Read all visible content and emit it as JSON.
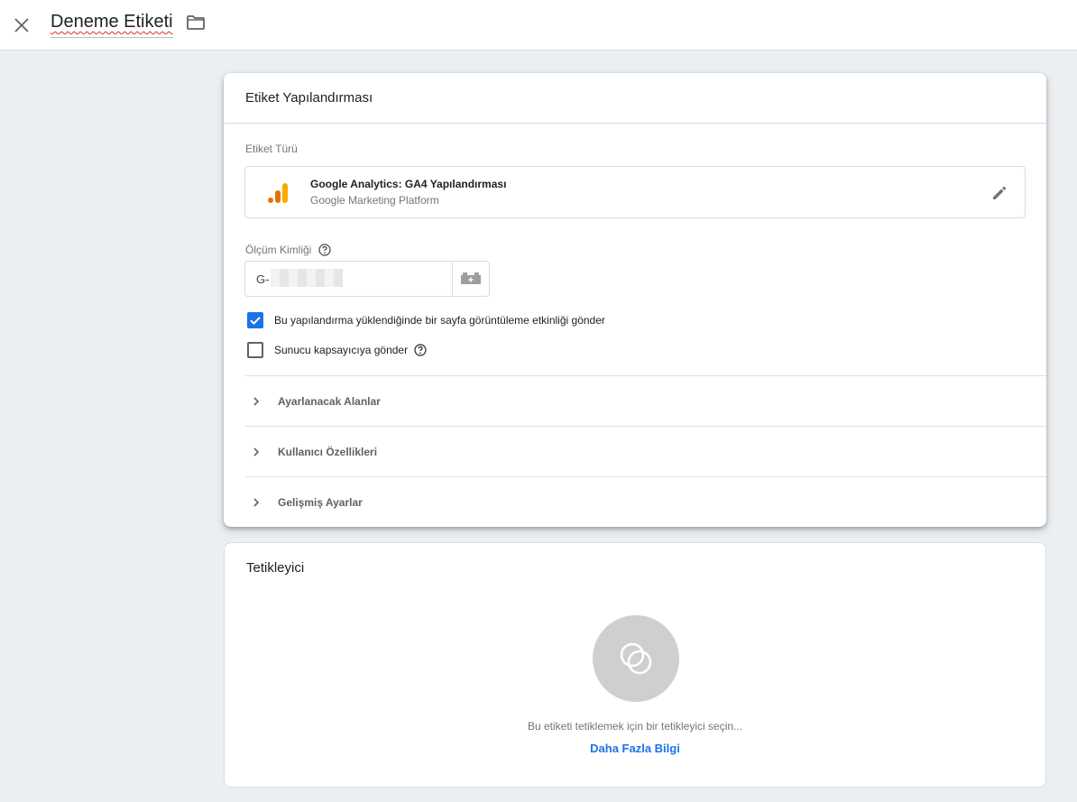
{
  "header": {
    "tag_name": "Deneme Etiketi"
  },
  "config_card": {
    "title": "Etiket Yapılandırması",
    "tag_type_label": "Etiket Türü",
    "tag_type": {
      "name": "Google Analytics: GA4 Yapılandırması",
      "platform": "Google Marketing Platform"
    },
    "measurement_id_label": "Ölçüm Kimliği",
    "measurement_id_value": "G-",
    "checkboxes": [
      {
        "label": "Bu yapılandırma yüklendiğinde bir sayfa görüntüleme etkinliği gönder",
        "checked": true
      },
      {
        "label": "Sunucu kapsayıcıya gönder",
        "checked": false
      }
    ],
    "sections": [
      {
        "label": "Ayarlanacak Alanlar"
      },
      {
        "label": "Kullanıcı Özellikleri"
      },
      {
        "label": "Gelişmiş Ayarlar"
      }
    ]
  },
  "trigger_card": {
    "title": "Tetikleyici",
    "hint": "Bu etiketi tetiklemek için bir tetikleyici seçin...",
    "learn_more": "Daha Fazla Bilgi"
  },
  "icons": {
    "close": "close-icon",
    "folder": "folder-icon",
    "analytics": "google-analytics-icon",
    "edit": "pencil-icon",
    "variable": "variable-lego-icon",
    "help": "help-circle-icon",
    "chevron": "chevron-right-icon",
    "trigger": "trigger-circles-icon"
  },
  "colors": {
    "accent": "#1a73e8",
    "analytics_orange": "#f9ab00",
    "analytics_dark_orange": "#e37400"
  }
}
